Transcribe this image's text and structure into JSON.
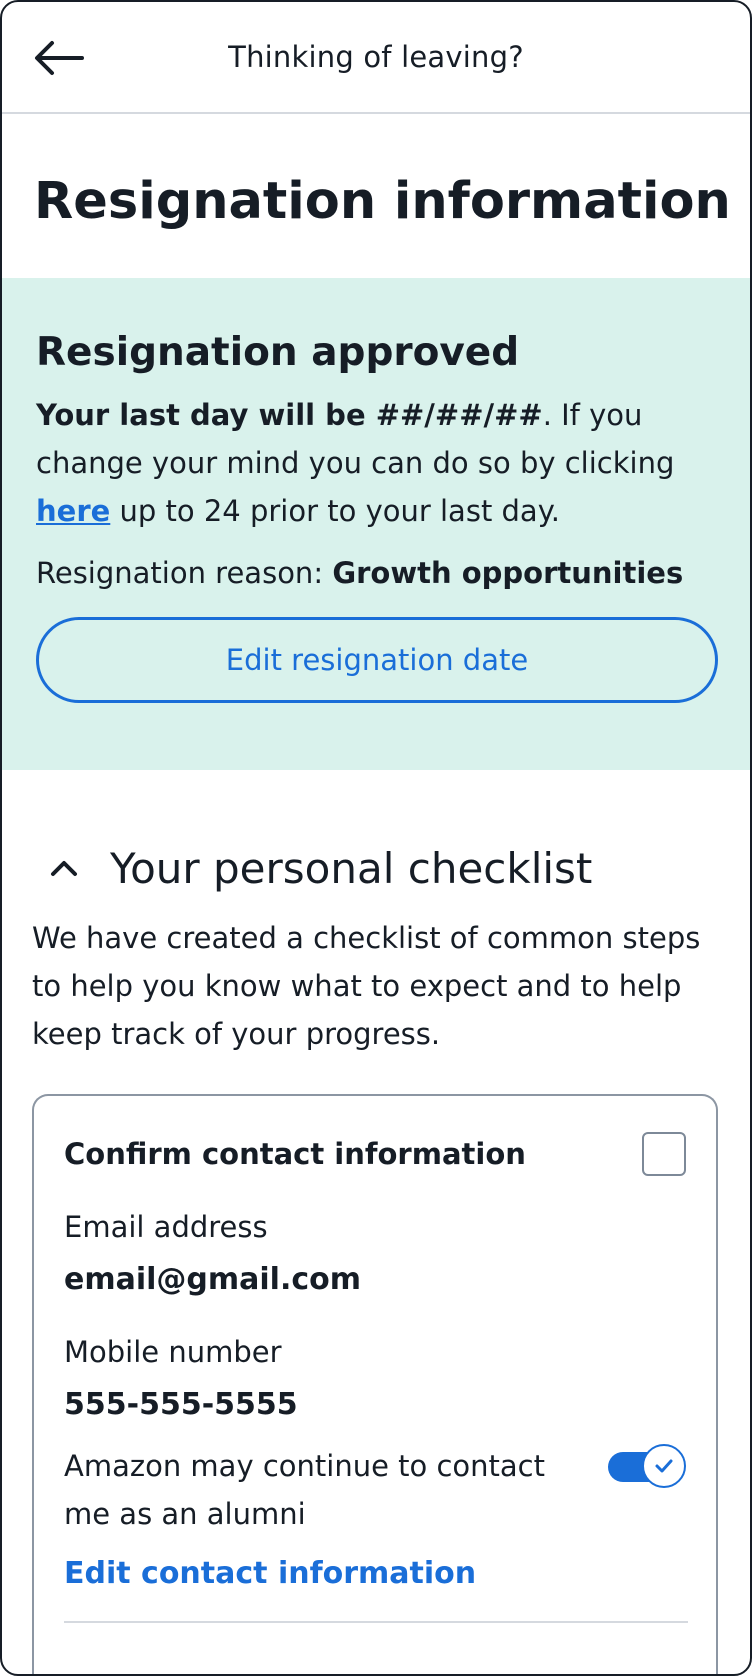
{
  "header": {
    "title": "Thinking of leaving?",
    "back_icon": "arrow-left-icon"
  },
  "page": {
    "title": "Resignation information"
  },
  "banner": {
    "heading": "Resignation approved",
    "last_day_bold": "Your last day will be ##/##/##",
    "body_part1": ". If you change your mind you can do so by clicking ",
    "link_text": "here",
    "body_part2": " up to 24 prior to your last day.",
    "reason_label": "Resignation reason: ",
    "reason_value": "Growth opportunities",
    "edit_button": "Edit resignation date",
    "background_color": "#d9f2ec",
    "accent_color": "#1a6ed8"
  },
  "checklist": {
    "title": "Your personal checklist",
    "chevron_icon": "chevron-up-icon",
    "description": "We have created a checklist of common steps to help you know what to expect and to help keep track of your progress.",
    "card": {
      "title": "Confirm contact information",
      "checkbox_checked": false,
      "email_label": "Email address",
      "email_value": "email@gmail.com",
      "mobile_label": "Mobile number",
      "mobile_value": "555-555-5555",
      "consent_text": "Amazon may continue to contact me as an alumni",
      "consent_toggle_on": true,
      "edit_link": "Edit contact information"
    }
  }
}
